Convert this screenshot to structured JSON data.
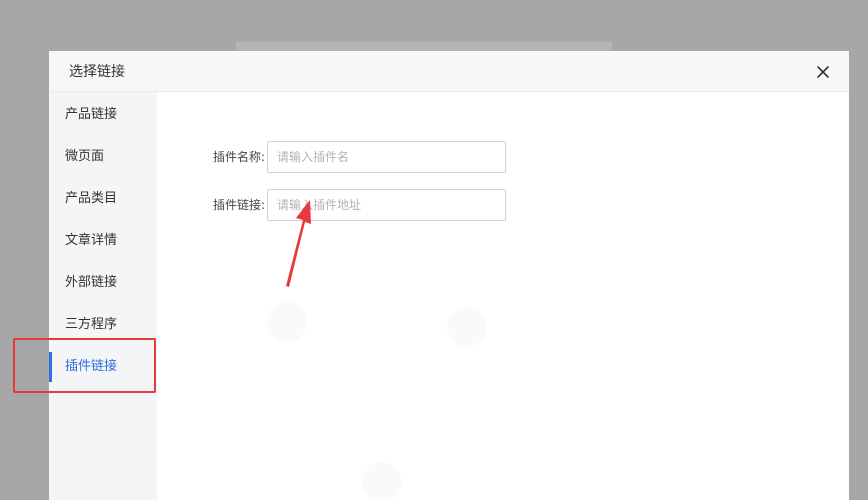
{
  "modal": {
    "title": "选择链接",
    "close_icon": "close-icon"
  },
  "sidebar": {
    "items": [
      {
        "label": "产品链接",
        "active": false
      },
      {
        "label": "微页面",
        "active": false
      },
      {
        "label": "产品类目",
        "active": false
      },
      {
        "label": "文章详情",
        "active": false
      },
      {
        "label": "外部链接",
        "active": false
      },
      {
        "label": "三方程序",
        "active": false
      },
      {
        "label": "插件链接",
        "active": true
      }
    ]
  },
  "form": {
    "plugin_name_label": "插件名称:",
    "plugin_name_placeholder": "请输入插件名",
    "plugin_name_value": "",
    "plugin_link_label": "插件链接:",
    "plugin_link_placeholder": "请输入插件地址",
    "plugin_link_value": ""
  },
  "colors": {
    "accent": "#2f6fe0",
    "annotation": "#e83a3a",
    "overlay": "#a7a7a7"
  }
}
